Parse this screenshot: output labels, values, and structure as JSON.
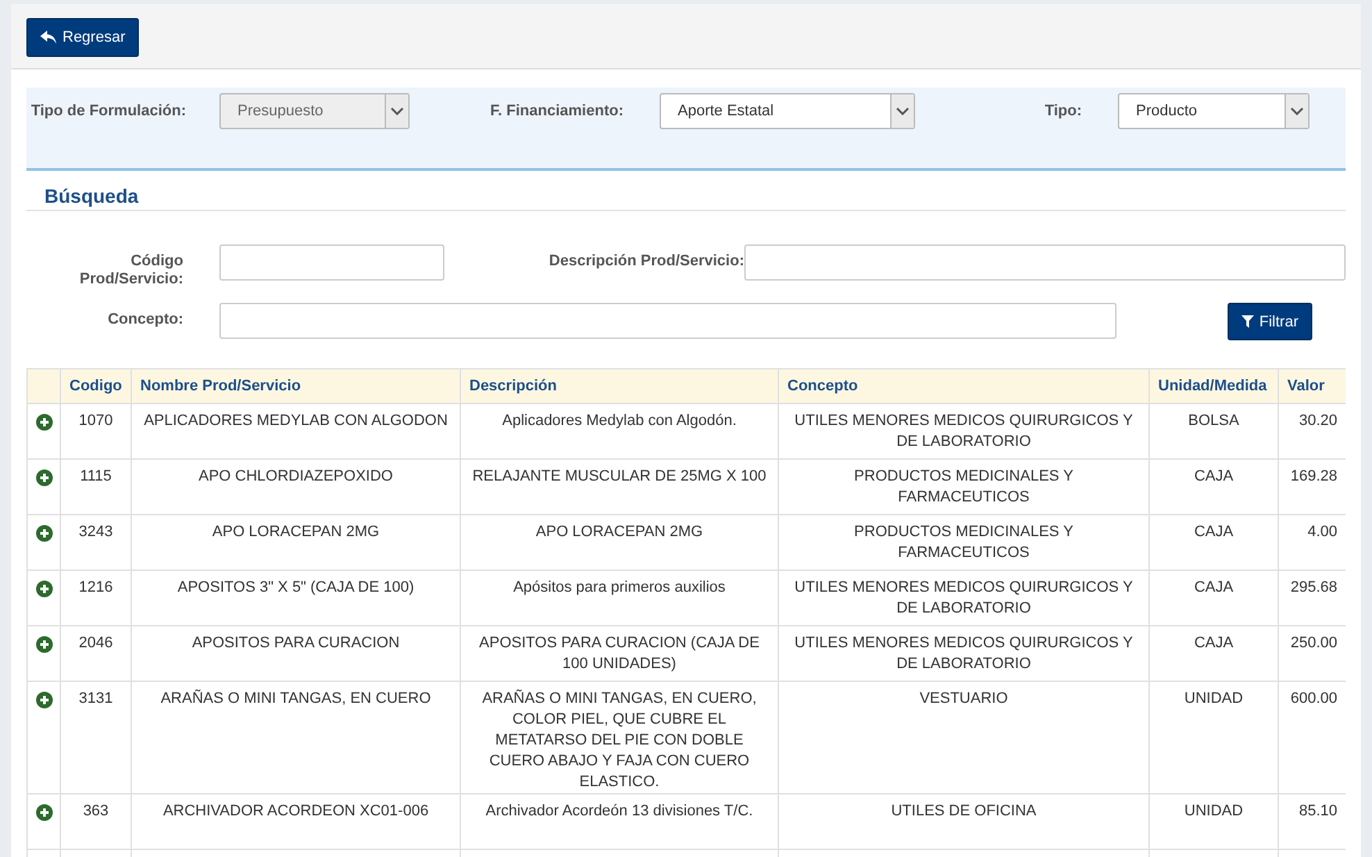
{
  "back_button": {
    "label": "Regresar"
  },
  "filters": [
    {
      "label": "Tipo de Formulación:",
      "value": "Presupuesto",
      "disabled": true
    },
    {
      "label": "F. Financiamiento:",
      "value": "Aporte Estatal",
      "disabled": false
    },
    {
      "label": "Tipo:",
      "value": "Producto",
      "disabled": false
    }
  ],
  "search": {
    "title": "Búsqueda",
    "code_label": "Código Prod/Servicio:",
    "description_label": "Descripción Prod/Servicio:",
    "concept_label": "Concepto:",
    "filter_button": "Filtrar"
  },
  "table": {
    "columns": [
      "Codigo",
      "Nombre Prod/Servicio",
      "Descripción",
      "Concepto",
      "Unidad/Medida",
      "Valor"
    ],
    "rows": [
      {
        "code": "1070",
        "name": "APLICADORES MEDYLAB CON ALGODON",
        "description": "Aplicadores Medylab con Algodón.",
        "concept": "UTILES MENORES MEDICOS QUIRURGICOS Y DE LABORATORIO",
        "unit": "BOLSA",
        "value": "30.20"
      },
      {
        "code": "1115",
        "name": "APO CHLORDIAZEPOXIDO",
        "description": "RELAJANTE MUSCULAR DE 25MG X 100",
        "concept": "PRODUCTOS MEDICINALES Y FARMACEUTICOS",
        "unit": "CAJA",
        "value": "169.28"
      },
      {
        "code": "3243",
        "name": "APO LORACEPAN 2MG",
        "description": "APO LORACEPAN 2MG",
        "concept": "PRODUCTOS MEDICINALES Y FARMACEUTICOS",
        "unit": "CAJA",
        "value": "4.00"
      },
      {
        "code": "1216",
        "name": "APOSITOS 3\" X 5\" (CAJA DE 100)",
        "description": "Apósitos para primeros auxilios",
        "concept": "UTILES MENORES MEDICOS QUIRURGICOS Y DE LABORATORIO",
        "unit": "CAJA",
        "value": "295.68"
      },
      {
        "code": "2046",
        "name": "APOSITOS PARA CURACION",
        "description": "APOSITOS PARA CURACION (CAJA DE 100 UNIDADES)",
        "concept": "UTILES MENORES MEDICOS QUIRURGICOS Y DE LABORATORIO",
        "unit": "CAJA",
        "value": "250.00"
      },
      {
        "code": "3131",
        "name": "ARAÑAS O MINI TANGAS, EN CUERO",
        "description": "ARAÑAS O MINI TANGAS, EN CUERO, COLOR PIEL, QUE CUBRE EL METATARSO DEL PIE CON DOBLE CUERO ABAJO Y FAJA CON CUERO ELASTICO.",
        "concept": "VESTUARIO",
        "unit": "UNIDAD",
        "value": "600.00"
      },
      {
        "code": "363",
        "name": "ARCHIVADOR ACORDEON XC01-006",
        "description": "Archivador Acordeón 13 divisiones T/C.",
        "concept": "UTILES DE OFICINA",
        "unit": "UNIDAD",
        "value": "85.10"
      }
    ]
  }
}
